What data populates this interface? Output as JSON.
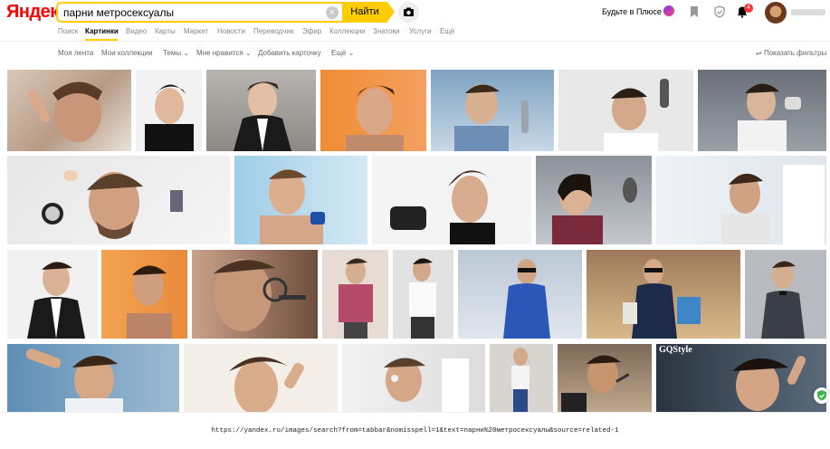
{
  "header": {
    "logo_text": "Яндекс",
    "search_query": "парни метросексуалы",
    "search_button_label": "Найти",
    "plus_link": "Будьте в Плюсе",
    "notification_count": "4"
  },
  "nav": {
    "items": [
      "Поиск",
      "Картинки",
      "Видео",
      "Карты",
      "Маркет",
      "Новости",
      "Переводчик",
      "Эфир",
      "Коллекции",
      "Знатоки",
      "Услуги",
      "Ещё"
    ],
    "active_index": 1
  },
  "subnav": {
    "items": [
      "Моя лента",
      "Мои коллекции",
      "Темы",
      "Мне нравится",
      "Добавить карточку",
      "Ещё"
    ],
    "filters_label": "Показать фильтры"
  },
  "status_bar": {
    "url": "https://yandex.ru/images/search?from=tabbar&nomisspell=1&text=парни%20метросексуалы&source=related-1"
  },
  "colors": {
    "accent": "#ffcc00",
    "logo_red": "#ff0000",
    "link_gray": "#888888"
  },
  "images": {
    "row1": [
      "Мужчина поправляет бровь",
      "Молодой человек в чёрном",
      "Мужчина в костюме",
      "Мужчина с бритвой",
      "Мужчина с лаком для волос",
      "Мужчина укладывает волосы",
      "Мужчина с феном"
    ],
    "row2": [
      "Мужчина с косметикой",
      "Мужчина наносит крем",
      "Мужчина укладывает причёску",
      "Мужчина с расчёской",
      "Мужчина у зеркала"
    ],
    "row3": [
      "Мужчина в пиджаке",
      "Мужчина на оранжевом фоне",
      "Мужчина с щипцами для ресниц",
      "Мужчина в шарфе",
      "Мужчина в белой рубашке",
      "Мужчина в синем костюме",
      "Мужчина с пакетами",
      "Мужчина в костюме и бабочке"
    ],
    "row4": [
      "Мужчина улыбается",
      "Мужчина поправляет волосы",
      "Мужчина наносит крем",
      "Мужчина в полный рост",
      "Мужчина с кистью",
      "GQ Style"
    ]
  },
  "gq_text": "GQStyle"
}
